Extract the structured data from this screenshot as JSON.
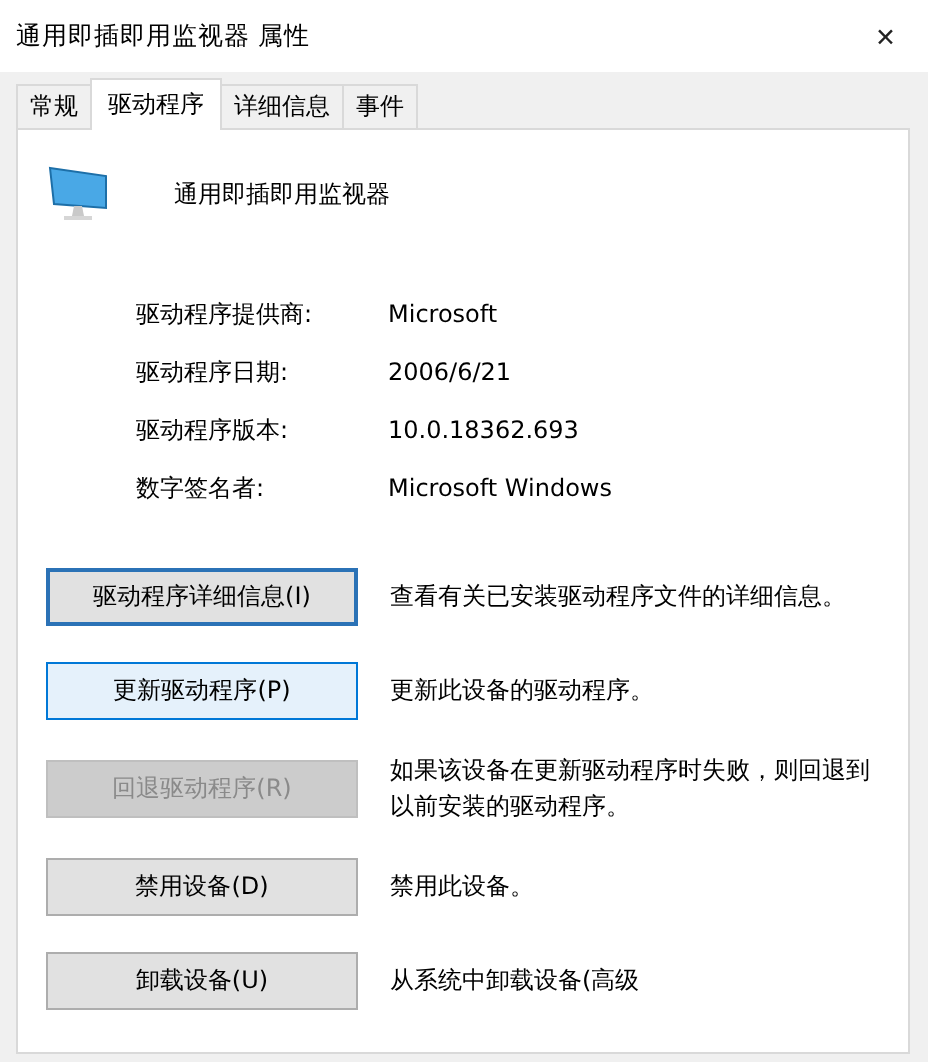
{
  "window": {
    "title": "通用即插即用监视器 属性",
    "close": "✕"
  },
  "tabs": [
    {
      "label": "常规",
      "selected": false
    },
    {
      "label": "驱动程序",
      "selected": true
    },
    {
      "label": "详细信息",
      "selected": false
    },
    {
      "label": "事件",
      "selected": false
    }
  ],
  "device": {
    "name": "通用即插即用监视器"
  },
  "properties": [
    {
      "label": "驱动程序提供商:",
      "value": "Microsoft"
    },
    {
      "label": "驱动程序日期:",
      "value": "2006/6/21"
    },
    {
      "label": "驱动程序版本:",
      "value": "10.0.18362.693"
    },
    {
      "label": "数字签名者:",
      "value": "Microsoft Windows"
    }
  ],
  "actions": [
    {
      "button": "驱动程序详细信息(I)",
      "description": "查看有关已安装驱动程序文件的详细信息。",
      "focused": true,
      "hovered": false,
      "disabled": false
    },
    {
      "button": "更新驱动程序(P)",
      "description": "更新此设备的驱动程序。",
      "focused": false,
      "hovered": true,
      "disabled": false
    },
    {
      "button": "回退驱动程序(R)",
      "description": "如果该设备在更新驱动程序时失败，则回退到以前安装的驱动程序。",
      "focused": false,
      "hovered": false,
      "disabled": true
    },
    {
      "button": "禁用设备(D)",
      "description": "禁用此设备。",
      "focused": false,
      "hovered": false,
      "disabled": false
    },
    {
      "button": "卸载设备(U)",
      "description": "从系统中卸载设备(高级",
      "focused": false,
      "hovered": false,
      "disabled": false
    }
  ]
}
